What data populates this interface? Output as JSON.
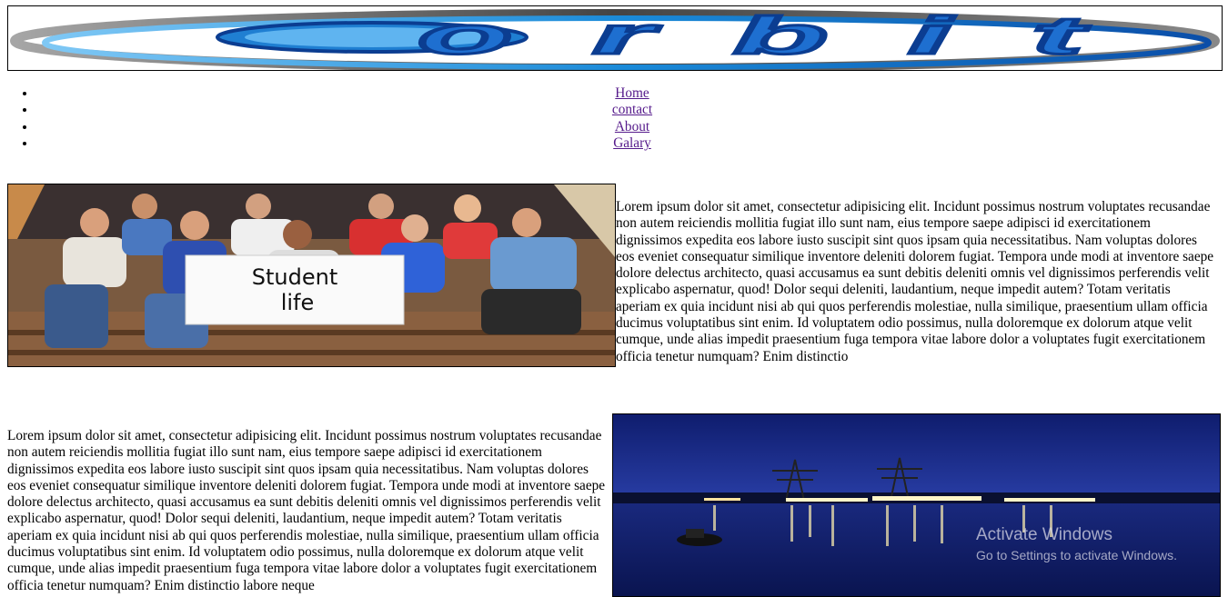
{
  "header": {
    "logo": {
      "icon": "orbit-logo",
      "text": "orbit"
    }
  },
  "nav": {
    "items": [
      {
        "label": "Home"
      },
      {
        "label": "contact"
      },
      {
        "label": "About"
      },
      {
        "label": "Galary"
      }
    ]
  },
  "section1": {
    "image": {
      "icon": "student-life-photo",
      "sign_text": "Student life"
    },
    "paragraph": "Lorem ipsum dolor sit amet, consectetur adipisicing elit. Incidunt possimus nostrum voluptates recusandae non autem reiciendis mollitia fugiat illo sunt nam, eius tempore saepe adipisci id exercitationem dignissimos expedita eos labore iusto suscipit sint quos ipsam quia necessitatibus. Nam voluptas dolores eos eveniet consequatur similique inventore deleniti dolorem fugiat. Tempora unde modi at inventore saepe dolore delectus architecto, quasi accusamus ea sunt debitis deleniti omnis vel dignissimos perferendis velit explicabo aspernatur, quod! Dolor sequi deleniti, laudantium, neque impedit autem? Totam veritatis aperiam ex quia incidunt nisi ab qui quos perferendis molestiae, nulla similique, praesentium ullam officia ducimus voluptatibus sint enim. Id voluptatem odio possimus, nulla doloremque ex dolorum atque velit cumque, unde alias impedit praesentium fuga tempora vitae labore dolor a voluptates fugit exercitationem officia tenetur numquam? Enim distinctio"
  },
  "section2": {
    "paragraph": "Lorem ipsum dolor sit amet, consectetur adipisicing elit. Incidunt possimus nostrum voluptates recusandae non autem reiciendis mollitia fugiat illo sunt nam, eius tempore saepe adipisci id exercitationem dignissimos expedita eos labore iusto suscipit sint quos ipsam quia necessitatibus. Nam voluptas dolores eos eveniet consequatur similique inventore deleniti dolorem fugiat. Tempora unde modi at inventore saepe dolore delectus architecto, quasi accusamus ea sunt debitis deleniti omnis vel dignissimos perferendis velit explicabo aspernatur, quod! Dolor sequi deleniti, laudantium, neque impedit autem? Totam veritatis aperiam ex quia incidunt nisi ab qui quos perferendis molestiae, nulla similique, praesentium ullam officia ducimus voluptatibus sint enim. Id voluptatem odio possimus, nulla doloremque ex dolorum atque velit cumque, unde alias impedit praesentium fuga tempora vitae labore dolor a voluptates fugit exercitationem officia tenetur numquam? Enim distinctio labore neque",
    "image": {
      "icon": "night-river-photo"
    }
  },
  "watermark": {
    "title": "Activate Windows",
    "subtitle": "Go to Settings to activate Windows."
  },
  "colors": {
    "link": "#551a8b",
    "logo_blue": "#1a7fd0",
    "logo_dark_blue": "#0b3d91",
    "night_sky": "#1a2a8a"
  }
}
